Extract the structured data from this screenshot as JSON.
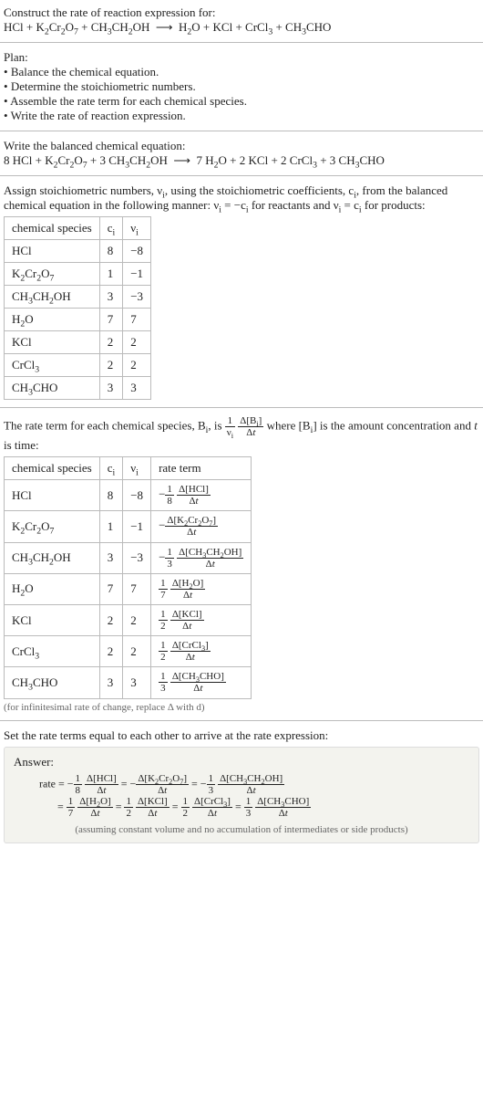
{
  "question": {
    "prompt": "Construct the rate of reaction expression for:",
    "equation_html": "HCl + K<sub>2</sub>Cr<sub>2</sub>O<sub>7</sub> + CH<sub>3</sub>CH<sub>2</sub>OH &nbsp;⟶&nbsp; H<sub>2</sub>O + KCl + CrCl<sub>3</sub> + CH<sub>3</sub>CHO"
  },
  "plan": {
    "heading": "Plan:",
    "items": [
      "Balance the chemical equation.",
      "Determine the stoichiometric numbers.",
      "Assemble the rate term for each chemical species.",
      "Write the rate of reaction expression."
    ]
  },
  "balanced": {
    "heading": "Write the balanced chemical equation:",
    "equation_html": "8 HCl + K<sub>2</sub>Cr<sub>2</sub>O<sub>7</sub> + 3 CH<sub>3</sub>CH<sub>2</sub>OH &nbsp;⟶&nbsp; 7 H<sub>2</sub>O + 2 KCl + 2 CrCl<sub>3</sub> + 3 CH<sub>3</sub>CHO"
  },
  "stoich": {
    "intro_html": "Assign stoichiometric numbers, ν<sub>i</sub>, using the stoichiometric coefficients, c<sub>i</sub>, from the balanced chemical equation in the following manner: ν<sub>i</sub> = −c<sub>i</sub> for reactants and ν<sub>i</sub> = c<sub>i</sub> for products:",
    "headers": [
      "chemical species",
      "c_i",
      "ν_i"
    ],
    "headers_html": [
      "chemical species",
      "c<sub>i</sub>",
      "ν<sub>i</sub>"
    ],
    "rows": [
      {
        "species_html": "HCl",
        "c": "8",
        "nu": "−8"
      },
      {
        "species_html": "K<sub>2</sub>Cr<sub>2</sub>O<sub>7</sub>",
        "c": "1",
        "nu": "−1"
      },
      {
        "species_html": "CH<sub>3</sub>CH<sub>2</sub>OH",
        "c": "3",
        "nu": "−3"
      },
      {
        "species_html": "H<sub>2</sub>O",
        "c": "7",
        "nu": "7"
      },
      {
        "species_html": "KCl",
        "c": "2",
        "nu": "2"
      },
      {
        "species_html": "CrCl<sub>3</sub>",
        "c": "2",
        "nu": "2"
      },
      {
        "species_html": "CH<sub>3</sub>CHO",
        "c": "3",
        "nu": "3"
      }
    ]
  },
  "rateterm": {
    "intro_html": "The rate term for each chemical species, B<sub>i</sub>, is <span class=\"frac\"><span class=\"num\">1</span><span class=\"den\">ν<sub>i</sub></span></span> <span class=\"frac\"><span class=\"num\">Δ[B<sub>i</sub>]</span><span class=\"den\">Δ<i>t</i></span></span> where [B<sub>i</sub>] is the amount concentration and <i>t</i> is time:",
    "headers_html": [
      "chemical species",
      "c<sub>i</sub>",
      "ν<sub>i</sub>",
      "rate term"
    ],
    "rows": [
      {
        "species_html": "HCl",
        "c": "8",
        "nu": "−8",
        "rate_html": "−<span class=\"frac\"><span class=\"num\">1</span><span class=\"den\">8</span></span> <span class=\"frac\"><span class=\"num\">Δ[HCl]</span><span class=\"den\">Δ<i>t</i></span></span>"
      },
      {
        "species_html": "K<sub>2</sub>Cr<sub>2</sub>O<sub>7</sub>",
        "c": "1",
        "nu": "−1",
        "rate_html": "−<span class=\"frac\"><span class=\"num\">Δ[K<sub>2</sub>Cr<sub>2</sub>O<sub>7</sub>]</span><span class=\"den\">Δ<i>t</i></span></span>"
      },
      {
        "species_html": "CH<sub>3</sub>CH<sub>2</sub>OH",
        "c": "3",
        "nu": "−3",
        "rate_html": "−<span class=\"frac\"><span class=\"num\">1</span><span class=\"den\">3</span></span> <span class=\"frac\"><span class=\"num\">Δ[CH<sub>3</sub>CH<sub>2</sub>OH]</span><span class=\"den\">Δ<i>t</i></span></span>"
      },
      {
        "species_html": "H<sub>2</sub>O",
        "c": "7",
        "nu": "7",
        "rate_html": "<span class=\"frac\"><span class=\"num\">1</span><span class=\"den\">7</span></span> <span class=\"frac\"><span class=\"num\">Δ[H<sub>2</sub>O]</span><span class=\"den\">Δ<i>t</i></span></span>"
      },
      {
        "species_html": "KCl",
        "c": "2",
        "nu": "2",
        "rate_html": "<span class=\"frac\"><span class=\"num\">1</span><span class=\"den\">2</span></span> <span class=\"frac\"><span class=\"num\">Δ[KCl]</span><span class=\"den\">Δ<i>t</i></span></span>"
      },
      {
        "species_html": "CrCl<sub>3</sub>",
        "c": "2",
        "nu": "2",
        "rate_html": "<span class=\"frac\"><span class=\"num\">1</span><span class=\"den\">2</span></span> <span class=\"frac\"><span class=\"num\">Δ[CrCl<sub>3</sub>]</span><span class=\"den\">Δ<i>t</i></span></span>"
      },
      {
        "species_html": "CH<sub>3</sub>CHO",
        "c": "3",
        "nu": "3",
        "rate_html": "<span class=\"frac\"><span class=\"num\">1</span><span class=\"den\">3</span></span> <span class=\"frac\"><span class=\"num\">Δ[CH<sub>3</sub>CHO]</span><span class=\"den\">Δ<i>t</i></span></span>"
      }
    ],
    "footnote": "(for infinitesimal rate of change, replace Δ with d)"
  },
  "final": {
    "heading": "Set the rate terms equal to each other to arrive at the rate expression:",
    "answer_label": "Answer:",
    "line1_html": "rate = −<span class=\"frac\"><span class=\"num\">1</span><span class=\"den\">8</span></span> <span class=\"frac\"><span class=\"num\">Δ[HCl]</span><span class=\"den\">Δ<i>t</i></span></span> = −<span class=\"frac\"><span class=\"num\">Δ[K<sub>2</sub>Cr<sub>2</sub>O<sub>7</sub>]</span><span class=\"den\">Δ<i>t</i></span></span> = −<span class=\"frac\"><span class=\"num\">1</span><span class=\"den\">3</span></span> <span class=\"frac\"><span class=\"num\">Δ[CH<sub>3</sub>CH<sub>2</sub>OH]</span><span class=\"den\">Δ<i>t</i></span></span>",
    "line2_html": "= <span class=\"frac\"><span class=\"num\">1</span><span class=\"den\">7</span></span> <span class=\"frac\"><span class=\"num\">Δ[H<sub>2</sub>O]</span><span class=\"den\">Δ<i>t</i></span></span> = <span class=\"frac\"><span class=\"num\">1</span><span class=\"den\">2</span></span> <span class=\"frac\"><span class=\"num\">Δ[KCl]</span><span class=\"den\">Δ<i>t</i></span></span> = <span class=\"frac\"><span class=\"num\">1</span><span class=\"den\">2</span></span> <span class=\"frac\"><span class=\"num\">Δ[CrCl<sub>3</sub>]</span><span class=\"den\">Δ<i>t</i></span></span> = <span class=\"frac\"><span class=\"num\">1</span><span class=\"den\">3</span></span> <span class=\"frac\"><span class=\"num\">Δ[CH<sub>3</sub>CHO]</span><span class=\"den\">Δ<i>t</i></span></span>",
    "assumption": "(assuming constant volume and no accumulation of intermediates or side products)"
  }
}
